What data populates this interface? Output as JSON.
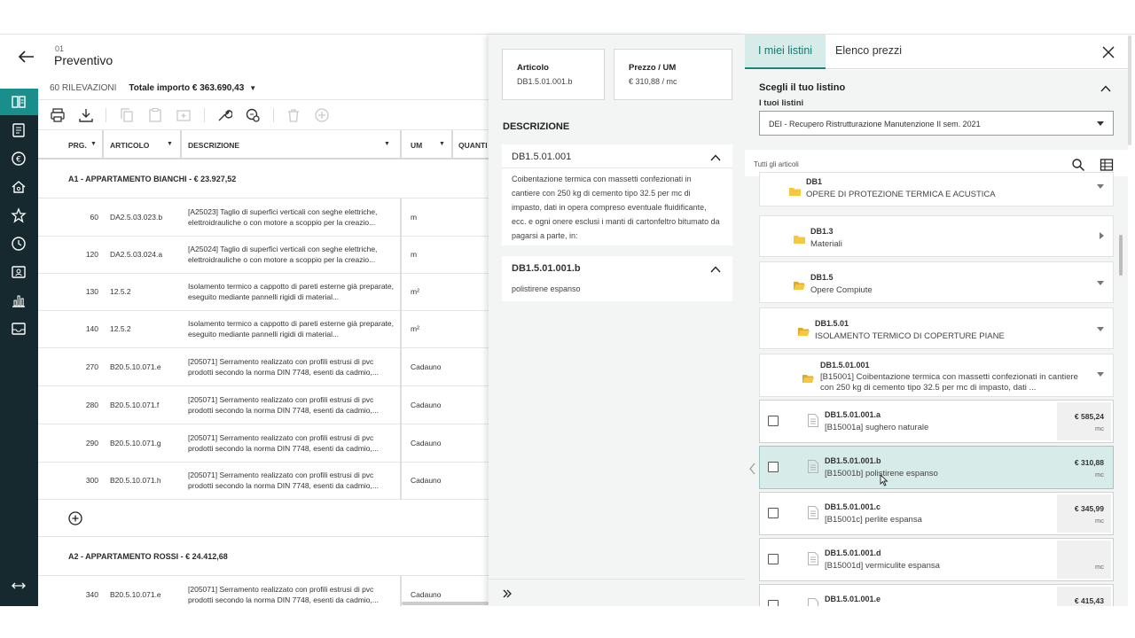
{
  "header": {
    "crumb_num": "01",
    "title": "Preventivo"
  },
  "summary": {
    "count": "60 RILEVAZIONI",
    "total": "Totale importo € 363.690,43"
  },
  "table": {
    "columns": {
      "prg": "PRG.",
      "articolo": "ARTICOLO",
      "descrizione": "DESCRIZIONE",
      "um": "UM",
      "quantita": "QUANTI"
    },
    "groups": [
      {
        "label": "A1 - APPARTAMENTO BIANCHI - € 23.927,52"
      },
      {
        "label": "A2 - APPARTAMENTO ROSSI - € 24.412,68"
      }
    ],
    "rows": [
      {
        "prg": "60",
        "art": "DA2.5.03.023.b",
        "desc": "[A25023] Taglio di superfici verticali con seghe elettriche, elettroidrauliche o con motore a scoppio per la creazio...",
        "um": "m"
      },
      {
        "prg": "120",
        "art": "DA2.5.03.024.a",
        "desc": "[A25024] Taglio di superfici verticali con seghe elettriche, elettroidrauliche o con motore a scoppio per la creazio...",
        "um": "m"
      },
      {
        "prg": "130",
        "art": "12.5.2",
        "desc": "Isolamento termico a cappotto di pareti esterne già preparate, eseguito mediante pannelli rigidi di material...",
        "um": "m²"
      },
      {
        "prg": "140",
        "art": "12.5.2",
        "desc": "Isolamento termico a cappotto di pareti esterne già preparate, eseguito mediante pannelli rigidi di material...",
        "um": "m²"
      },
      {
        "prg": "270",
        "art": "B20.5.10.071.e",
        "desc": "[205071] Serramento realizzato con profili estrusi di pvc prodotti secondo la norma DIN 7748, esenti da cadmio,...",
        "um": "Cadauno"
      },
      {
        "prg": "280",
        "art": "B20.5.10.071.f",
        "desc": "[205071] Serramento realizzato con profili estrusi di pvc prodotti secondo la norma DIN 7748, esenti da cadmio,...",
        "um": "Cadauno"
      },
      {
        "prg": "290",
        "art": "B20.5.10.071.g",
        "desc": "[205071] Serramento realizzato con profili estrusi di pvc prodotti secondo la norma DIN 7748, esenti da cadmio,...",
        "um": "Cadauno"
      },
      {
        "prg": "300",
        "art": "B20.5.10.071.h",
        "desc": "[205071] Serramento realizzato con profili estrusi di pvc prodotti secondo la norma DIN 7748, esenti da cadmio,...",
        "um": "Cadauno"
      },
      {
        "prg": "340",
        "art": "B20.5.10.071.e",
        "desc": "[205071] Serramento realizzato con profili estrusi di pvc prodotti secondo la norma DIN 7748, esenti da cadmio,...",
        "um": "Cadauno"
      }
    ]
  },
  "detail": {
    "articolo_label": "Articolo",
    "articolo_value": "DB1.5.01.001.b",
    "prezzo_label": "Prezzo / UM",
    "prezzo_value": "€ 310,88 / mc",
    "section_title": "DESCRIZIONE",
    "acc1_title": "DB1.5.01.001",
    "acc1_body": "Coibentazione termica con massetti confezionati in cantiere con 250 kg di cemento tipo 32.5 per mc di impasto, dati in opera compreso eventuale fluidificante, ecc. e ogni onere esclusi i manti di cartonfeltro bitumato da pagarsi a parte, in:",
    "acc2_title": "DB1.5.01.001.b",
    "acc2_body": "polistirene espanso"
  },
  "listini": {
    "tab_active": "I miei listini",
    "tab_other": "Elenco prezzi",
    "choose_title": "Scegli il tuo listino",
    "choose_label": "I tuoi listini",
    "selected": "DEI - Recupero Ristrutturazione Manutenzione II sem. 2021",
    "all_label": "Tutti gli articoli",
    "nodes": [
      {
        "code": "DB1",
        "name": "OPERE DI PROTEZIONE TERMICA E ACUSTICA"
      },
      {
        "code": "DB1.3",
        "name": "Materiali"
      },
      {
        "code": "DB1.5",
        "name": "Opere Compiute"
      },
      {
        "code": "DB1.5.01",
        "name": "ISOLAMENTO TERMICO DI COPERTURE PIANE"
      },
      {
        "code": "DB1.5.01.001",
        "name": "[B15001] Coibentazione termica con massetti confezionati in cantiere con 250 kg di cemento tipo 32.5 per mc di impasto, dati ..."
      }
    ],
    "items": [
      {
        "code": "DB1.5.01.001.a",
        "name": "[B15001a] sughero naturale",
        "price": "€ 585,24",
        "unit": "mc"
      },
      {
        "code": "DB1.5.01.001.b",
        "name": "[B15001b] polistirene espanso",
        "price": "€ 310,88",
        "unit": "mc"
      },
      {
        "code": "DB1.5.01.001.c",
        "name": "[B15001c] perlite espansa",
        "price": "€ 345,99",
        "unit": "mc"
      },
      {
        "code": "DB1.5.01.001.d",
        "name": "[B15001d] vermiculite espansa",
        "price": "",
        "unit": "mc"
      },
      {
        "code": "DB1.5.01.001.e",
        "name": "",
        "price": "€ 415,43",
        "unit": ""
      }
    ]
  },
  "colors": {
    "rail": "#15292f",
    "accent": "#1a8e8a",
    "highlight": "#d7ece9"
  },
  "icons": [
    "back-arrow-icon",
    "print-icon",
    "download-icon",
    "copy-icon",
    "paste-icon",
    "duplicate-icon",
    "wrench-icon",
    "sync-icon",
    "trash-icon",
    "add-circle-icon",
    "search-icon",
    "table-view-icon",
    "close-icon",
    "folder-icon",
    "document-icon",
    "expand-icon"
  ]
}
